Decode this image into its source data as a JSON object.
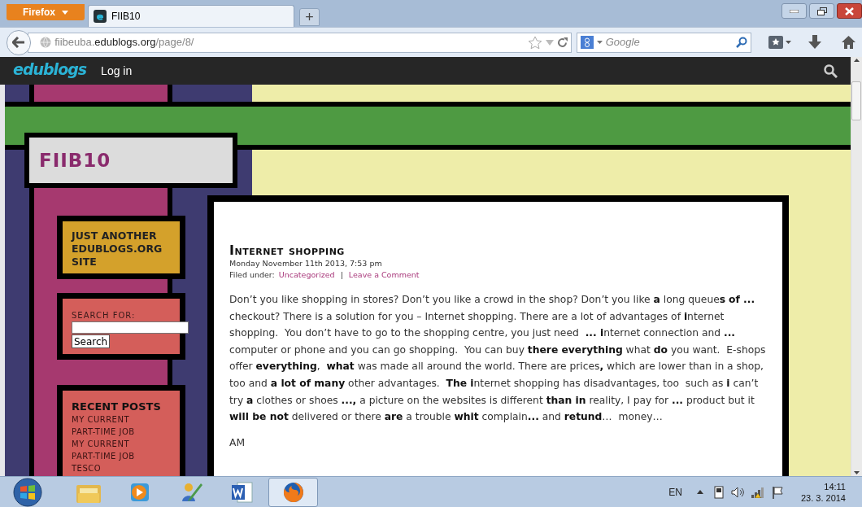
{
  "browser": {
    "menu_button": "Firefox",
    "tabs": [
      {
        "title": "FIIB10",
        "selected": true
      }
    ],
    "new_tab": "+",
    "address": "fiibeuba.**edublogs.org**/page/8/",
    "search": {
      "placeholder": "Google"
    }
  },
  "admin_bar": {
    "logo": "edublogs",
    "login": "Log in"
  },
  "site": {
    "title": "FIIB10",
    "tagline": "JUST ANOTHER EDUBLOGS.ORG SITE",
    "search_widget": {
      "label": "SEARCH FOR:",
      "button": "Search"
    },
    "recent_posts": {
      "heading": "RECENT POSTS",
      "items": [
        "MY CURRENT PART-TIME JOB",
        "MY CURRENT PART-TIME JOB",
        "TESCO"
      ]
    }
  },
  "post": {
    "title": "Internet shopping",
    "date": "Monday November 11th 2013, 7:53 pm",
    "filed_label": "Filed under:",
    "category": "Uncategorized",
    "separator": "|",
    "comment_link": "Leave a Comment",
    "body": "Don’t you like shopping in stores? Don’t you like a crowd in the shop? Don’t you like **a** long queue**s** **of ...** checkout? There is a solution for you – Internet shopping. There are a lot of advantages of **i**nternet shopping.  You don’t have to go to the shopping centre, you just need  **... i**nternet connection and **...** computer or phone and you can go shopping.  You can buy **there everything** what **do** you want.  E-shops offer **everything**,  **what** was made all around the world. There are prices**,** which are lower than in a shop, too and **a lot of many** other advantages.  **The i**nternet shopping has disadvantages, too  such as **i** can’t try **a** clothes or shoes **...,** a picture on the websites is different **than in** reality, I pay for **...** product but it **will be not** delivered or there **are** a trouble **whit** complain**...** and **retund**…  money…",
    "signature": "AM"
  },
  "taskbar": {
    "apps": [
      {
        "kind": "folder",
        "selected": false
      },
      {
        "kind": "media",
        "selected": false
      },
      {
        "kind": "tool",
        "selected": false
      },
      {
        "kind": "word",
        "selected": false
      },
      {
        "kind": "firefox",
        "selected": true
      }
    ],
    "language": "EN",
    "time": "14:11",
    "date": "23. 3. 2014"
  }
}
